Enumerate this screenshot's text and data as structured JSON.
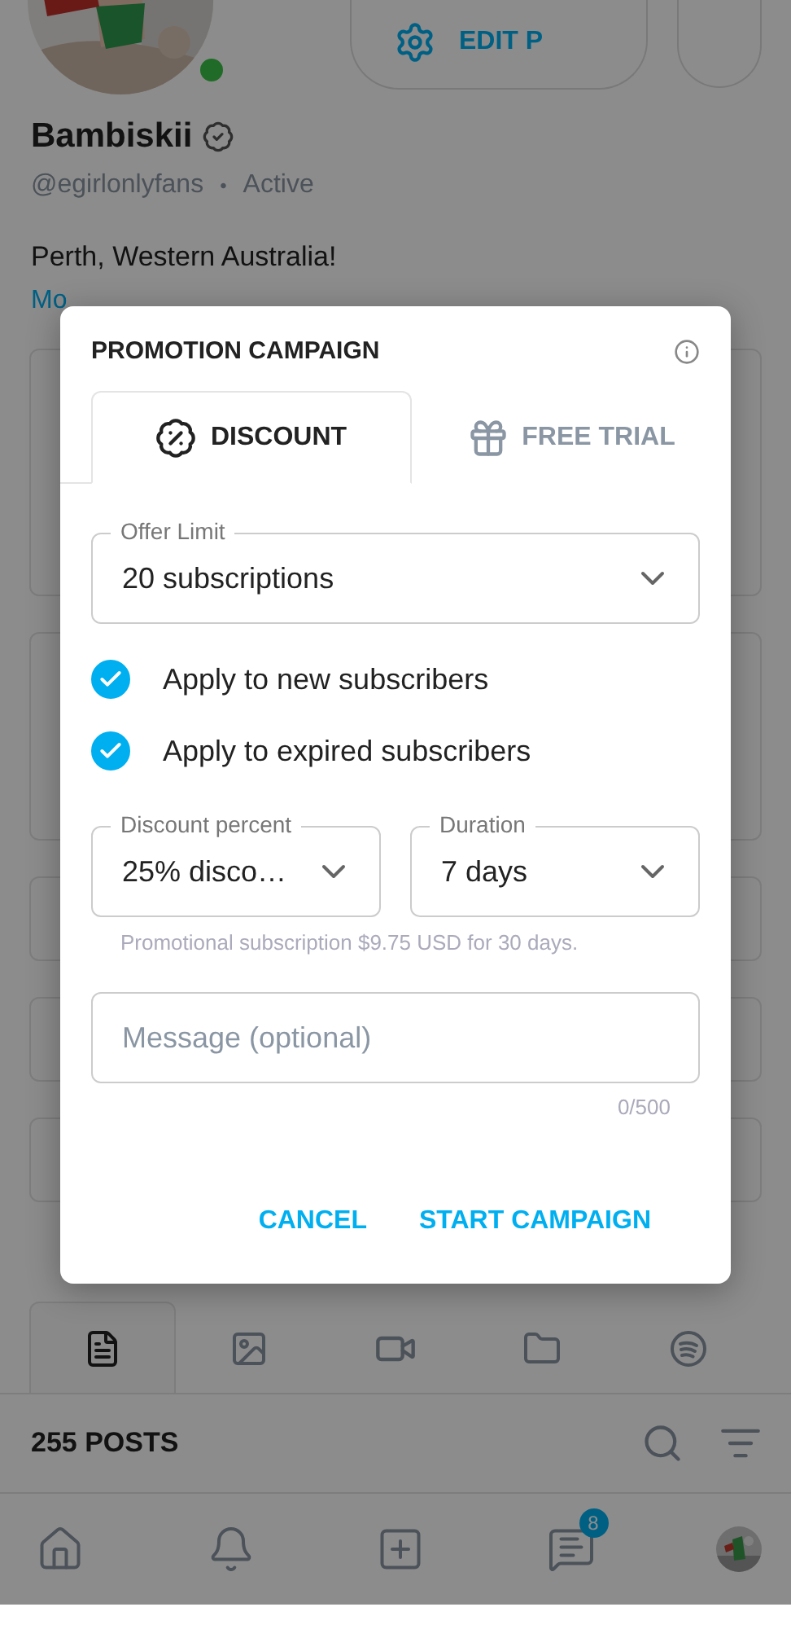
{
  "profile": {
    "name": "Bambiskii",
    "verified": true,
    "handle": "@egirlonlyfans",
    "separator": "•",
    "status": "Active",
    "online": true,
    "bio": "Perth, Western Australia!",
    "more_link": "Mo",
    "edit_button": "EDIT P"
  },
  "content_tabs": [
    {
      "kind": "posts",
      "selected": true
    },
    {
      "kind": "photos",
      "selected": false
    },
    {
      "kind": "videos",
      "selected": false
    },
    {
      "kind": "folders",
      "selected": false
    },
    {
      "kind": "music",
      "selected": false
    }
  ],
  "posts_bar": {
    "count": "255 POSTS"
  },
  "bottom_nav": [
    {
      "kind": "home"
    },
    {
      "kind": "notifications"
    },
    {
      "kind": "add"
    },
    {
      "kind": "messages",
      "badge": "8"
    },
    {
      "kind": "avatar"
    }
  ],
  "dialog": {
    "title": "PROMOTION CAMPAIGN",
    "tabs": [
      {
        "kind": "discount",
        "label": "DISCOUNT",
        "selected": true
      },
      {
        "kind": "trial",
        "label": "FREE TRIAL",
        "selected": false
      }
    ],
    "offer_limit": {
      "label": "Offer Limit",
      "value": "20 subscriptions"
    },
    "options": [
      {
        "label": "Apply to new subscribers",
        "checked": true
      },
      {
        "label": "Apply to expired subscribers",
        "checked": true
      }
    ],
    "discount": {
      "label": "Discount percent",
      "value": "25% disco…"
    },
    "duration": {
      "label": "Duration",
      "value": "7 days"
    },
    "note": "Promotional subscription $9.75 USD for 30 days.",
    "message": {
      "placeholder": "Message (optional)",
      "counter": "0/500"
    },
    "buttons": [
      "CANCEL",
      "START CAMPAIGN"
    ]
  }
}
